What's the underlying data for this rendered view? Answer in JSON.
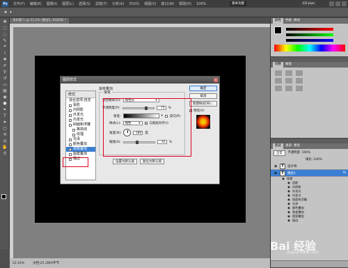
{
  "menubar": {
    "logo": "Ps",
    "items": [
      "文件(F)",
      "编辑(E)",
      "图像(I)",
      "图层(L)",
      "选择(S)",
      "滤镜(T)",
      "分析(A)",
      "3D(D)",
      "视图(V)",
      "窗口(W)",
      "帮助(H)"
    ],
    "zoom": "100%",
    "workspace": "基本功能",
    "cslive": "CS Live"
  },
  "document": {
    "tab": "未标题-1 @ 22.2% (图层1, RGB/8) *",
    "status_zoom": "22.16%",
    "status_doc": "文档:25.3M/0字节"
  },
  "dialog": {
    "title": "图层样式",
    "styles_header": "样式",
    "blend_options": "混合选项:自定",
    "effects": [
      {
        "label": "投影",
        "checked": true
      },
      {
        "label": "内阴影",
        "checked": true
      },
      {
        "label": "外发光",
        "checked": true
      },
      {
        "label": "内发光",
        "checked": true
      },
      {
        "label": "斜面和浮雕",
        "checked": true
      },
      {
        "label": "等高线",
        "checked": true
      },
      {
        "label": "纹理",
        "checked": true
      },
      {
        "label": "光泽",
        "checked": true
      },
      {
        "label": "颜色叠加",
        "checked": true
      },
      {
        "label": "渐变叠加",
        "checked": true,
        "selected": true
      },
      {
        "label": "图案叠加",
        "checked": true
      },
      {
        "label": "描边",
        "checked": true
      }
    ],
    "section_title": "渐变叠加",
    "group_title": "渐变",
    "blend_mode_label": "混合模式(O):",
    "blend_mode_value": "线性光",
    "opacity_label": "不透明度(P):",
    "opacity_value": "75",
    "opacity_pct": 75,
    "gradient_label": "渐变:",
    "reverse_label": "反向(R)",
    "style_label": "样式(L):",
    "style_value": "线性",
    "align_label": "与图层对齐(I)",
    "angle_label": "角度(N):",
    "angle_value": "180",
    "angle_unit": "度",
    "scale_label": "缩放(S):",
    "scale_value": "41",
    "scale_pct": 41,
    "percent": "%",
    "btn_default": "设置为默认值",
    "btn_reset": "复位为默认值",
    "ok": "确定",
    "cancel": "取消",
    "new_style": "新建样式(W)...",
    "preview": "预览(V)"
  },
  "panels": {
    "color_tabs": [
      "颜色",
      "色板",
      "样式"
    ],
    "adjust_tabs": [
      "调整",
      "蒙版"
    ],
    "layers_tabs": [
      "图层",
      "通道",
      "路径"
    ],
    "blend": "正常",
    "opacity": "不透明度: 100%",
    "fill": "填充: 100%",
    "layers": [
      {
        "name": "设计师",
        "selected": false
      },
      {
        "name": "图层1",
        "selected": true
      }
    ],
    "fx_label": "效果",
    "fx_items": [
      "投影",
      "内阴影",
      "外发光",
      "内发光",
      "斜面和浮雕",
      "光泽",
      "颜色叠加",
      "渐变叠加",
      "图案叠加",
      "描边"
    ]
  },
  "watermark": {
    "text": "Bai 经验",
    "url": "jingyan.baidu.com"
  }
}
